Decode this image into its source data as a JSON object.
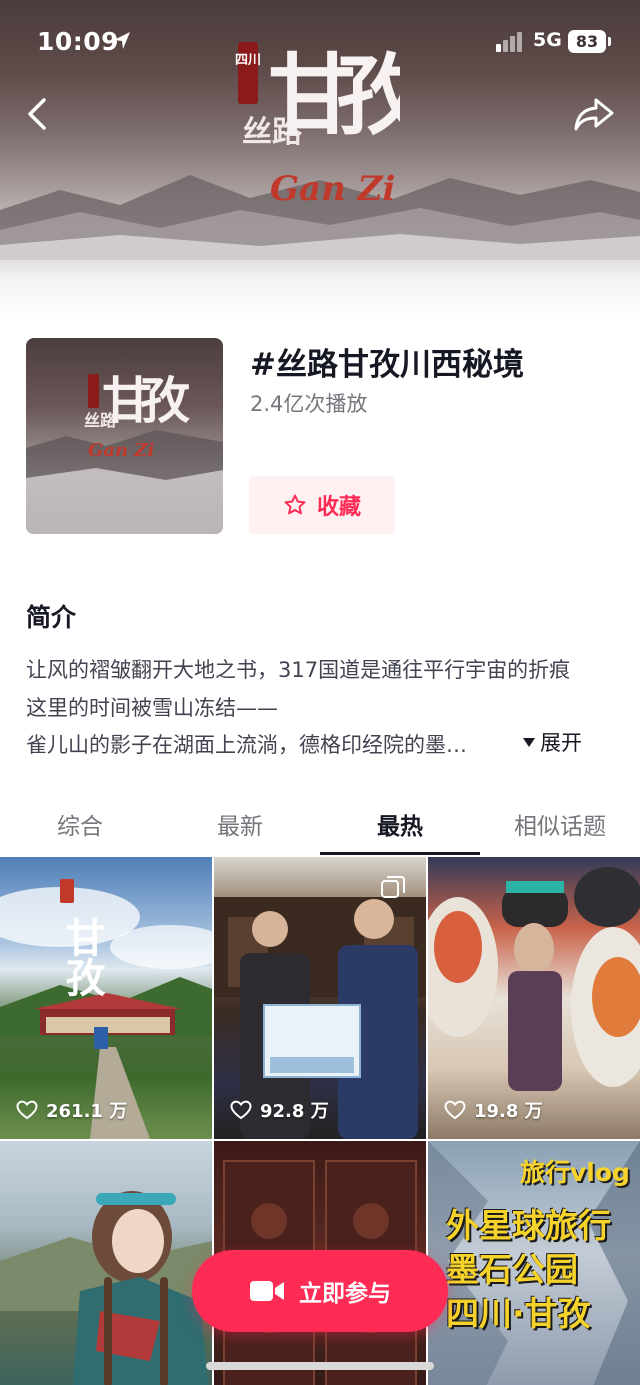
{
  "status_bar": {
    "time": "10:09",
    "network": "5G",
    "battery": "83"
  },
  "hero": {
    "calligraphy": "甘孜",
    "sub_calligraphy": "丝路",
    "roman": "Gan Zi",
    "seal": "四川"
  },
  "topic": {
    "title": "#丝路甘孜川西秘境",
    "plays": "2.4亿次播放",
    "favorite_label": "收藏"
  },
  "intro": {
    "heading": "简介",
    "line1": "让风的褶皱翻开大地之书，317国道是通往平行宇宙的折痕",
    "line2": "这里的时间被雪山冻结——",
    "line3": "雀儿山的影子在湖面上流淌，德格印经院的墨…",
    "expand_label": "展开"
  },
  "tabs": [
    {
      "label": "综合",
      "active": false
    },
    {
      "label": "最新",
      "active": false
    },
    {
      "label": "最热",
      "active": true
    },
    {
      "label": "相似话题",
      "active": false
    }
  ],
  "videos": [
    {
      "likes": "261.1 万",
      "overlay": "甘孜",
      "seal": "四川"
    },
    {
      "likes": "92.8 万"
    },
    {
      "likes": "19.8 万"
    },
    {},
    {},
    {
      "overlay_small": "旅行vlog",
      "overlay_lines": [
        "外星球旅行",
        "墨石公园",
        "四川·甘孜"
      ]
    }
  ],
  "join_button": {
    "label": "立即参与"
  },
  "colors": {
    "accent": "#fe2c55",
    "text_primary": "#161823",
    "text_secondary": "#75767c"
  }
}
